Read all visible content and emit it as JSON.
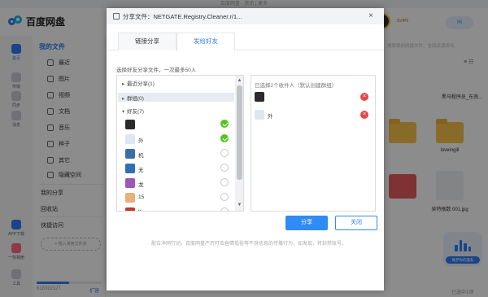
{
  "window": {
    "title": "百度网盘 - 资讯 | 更多"
  },
  "app": {
    "logo_text": "百度网盘",
    "rail": [
      {
        "label": "首页",
        "active": true
      },
      {
        "label": "传输"
      },
      {
        "label": "同步"
      },
      {
        "label": "消息"
      }
    ],
    "rail_bottom": [
      {
        "label": "APP下载"
      },
      {
        "label": "一刻相册"
      },
      {
        "label": "工具"
      }
    ],
    "sidebar": {
      "head": "我的文件",
      "items": [
        "最近",
        "图片",
        "视频",
        "文档",
        "音乐",
        "种子",
        "其它",
        "隐藏空间"
      ],
      "links": [
        "我的分享",
        "回收站"
      ],
      "quick_access": "快捷访问",
      "add_quick": "+ 拖入常用文件夹"
    },
    "storage": {
      "text": "6183G/12T",
      "expand": "扩容",
      "used_fraction": 0.5
    },
    "badge": "SVIP6",
    "hi": "Hi",
    "search_hint": "搜索我的网盘文件、全网资源资讯",
    "status_right": "已选中1项",
    "files": [
      {
        "name": "黑马程序员_东南..."
      },
      {
        "name": "loveingill"
      },
      {
        "name": "吴特根数 001.jpg"
      }
    ],
    "float_widget": "做梦你的雄私"
  },
  "dialog": {
    "title": "分享文件：NETGATE.Registry.Cleaner.r/1...",
    "close": "×",
    "tabs": [
      "链接分享",
      "发给好友"
    ],
    "active_tab": 1,
    "hint": "选择好友分享文件，一次最多50人",
    "tree": [
      {
        "label": "最近分享(1)",
        "caret": "▸"
      },
      {
        "label": "群组(0)",
        "caret": "▸"
      },
      {
        "label": "好友(7)",
        "caret": "▾"
      }
    ],
    "friends": [
      {
        "name": "",
        "color": "#2b2b2b",
        "checked": true
      },
      {
        "name": "外",
        "color": "#dfe6f2",
        "checked": true
      },
      {
        "name": "机",
        "color": "#3a6ea5",
        "checked": false
      },
      {
        "name": "无",
        "color": "#2f6fb3",
        "checked": false
      },
      {
        "name": "龙",
        "color": "#9b59b6",
        "checked": false
      },
      {
        "name": "15",
        "color": "#e8b07a",
        "checked": false
      },
      {
        "name": "K",
        "color": "#c0392b",
        "checked": false
      }
    ],
    "selected_info": "已选择2个收件人（默认创建群组）",
    "recipients": [
      {
        "name": "",
        "color": "#2b2b2b"
      },
      {
        "name": "外",
        "color": "#dfe6f2"
      }
    ],
    "share_button": "分享",
    "close_button": "关闭",
    "footer_note": "配合净网行动，百度网盘严厉打击色情低俗等不良信息的传播行为，如发现，将封禁账号。"
  }
}
